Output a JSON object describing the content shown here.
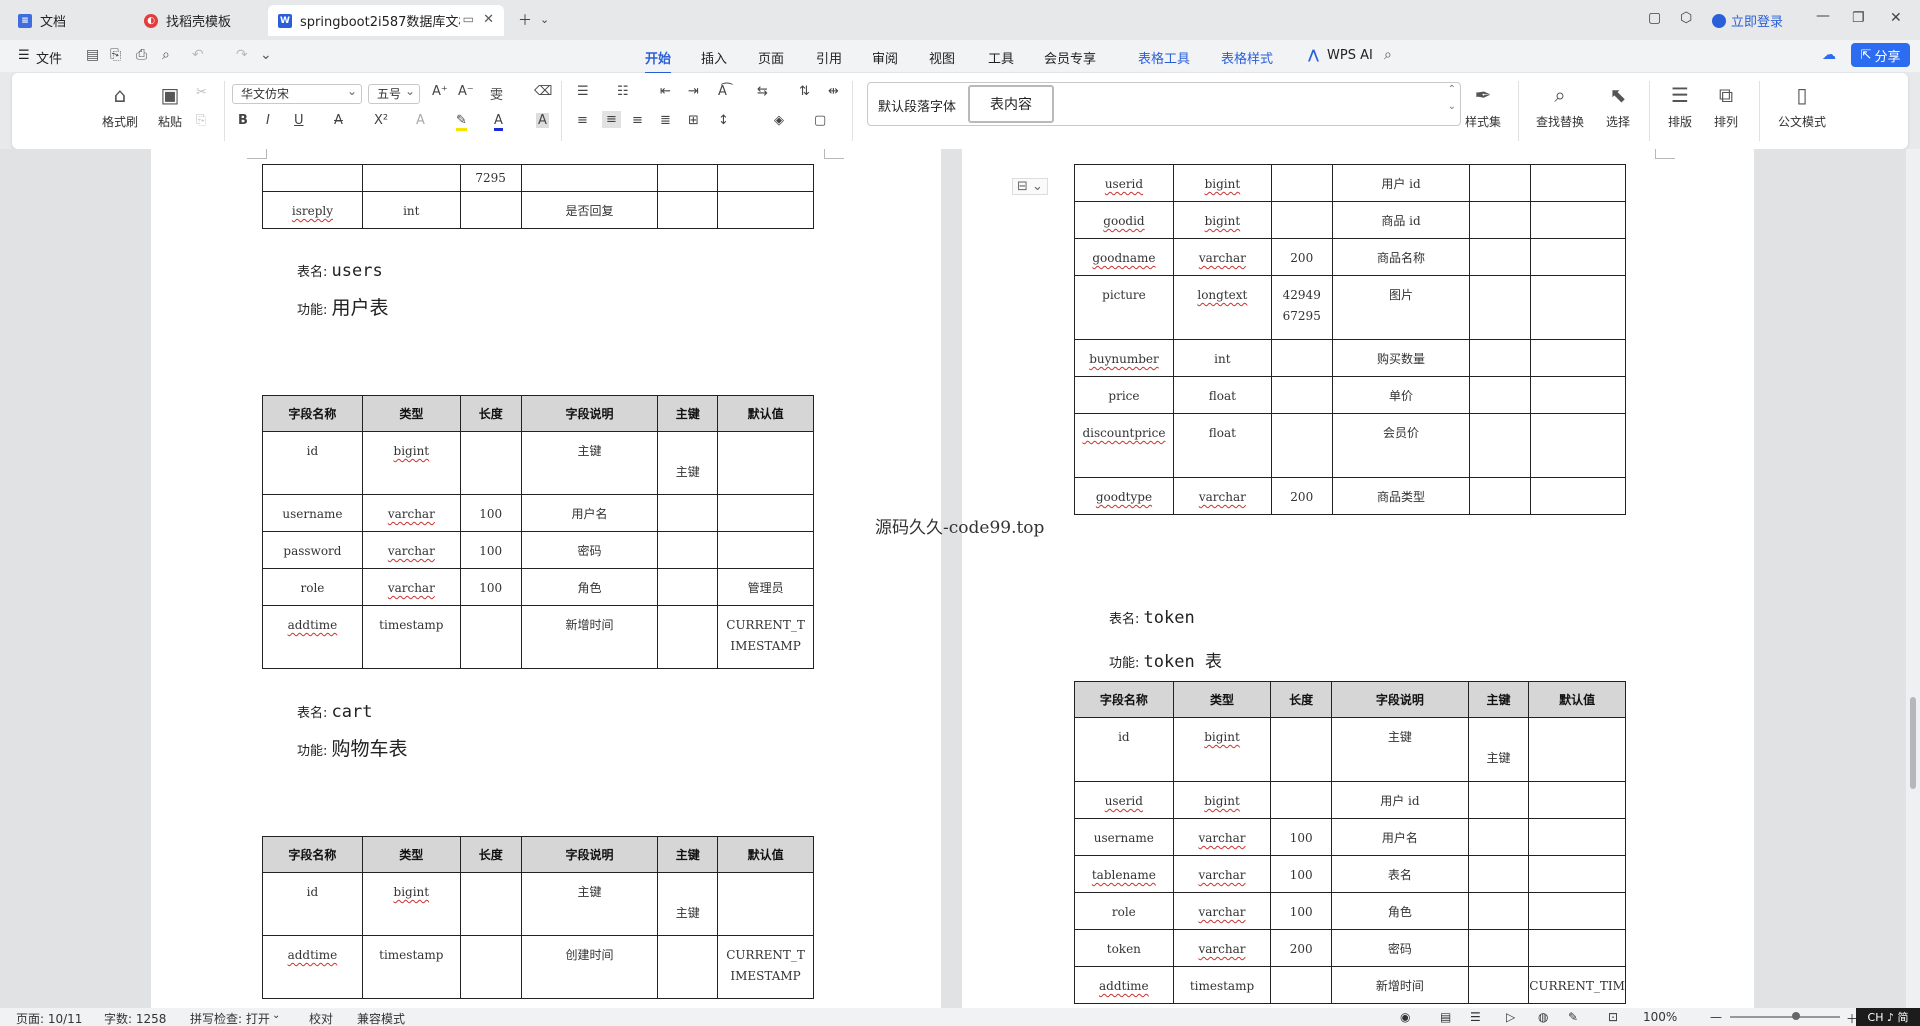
{
  "tabs": [
    {
      "label": "文档",
      "icon": "doc-icon",
      "color": "#3f6de0"
    },
    {
      "label": "找稻壳模板",
      "icon": "docer-icon",
      "color": "#e23c3c"
    },
    {
      "label": "springboot2i587数据库文档",
      "icon": "word-icon",
      "color": "#2b5fd9"
    }
  ],
  "login_label": "立即登录",
  "menu": {
    "file": "文件",
    "items": [
      "开始",
      "插入",
      "页面",
      "引用",
      "审阅",
      "视图",
      "工具",
      "会员专享",
      "表格工具",
      "表格样式"
    ],
    "ai": "WPS AI",
    "share": "分享"
  },
  "ribbon": {
    "format_painter": "格式刷",
    "paste": "粘贴",
    "font": "华文仿宋",
    "size": "五号",
    "style_normal": "默认段落字体",
    "style_table": "表内容",
    "style_set": "样式集",
    "find_replace": "查找替换",
    "select": "选择",
    "layout": "排版",
    "arrange": "排列",
    "official": "公文模式"
  },
  "left_page": {
    "top_table": {
      "rows": [
        [
          "",
          "",
          "7295",
          "",
          "",
          ""
        ],
        [
          "isreply",
          "int",
          "",
          "是否回复",
          "",
          ""
        ]
      ]
    },
    "users": {
      "name_label": "表名:",
      "name": "users",
      "func_label": "功能:",
      "func": "用户表",
      "headers": [
        "字段名称",
        "类型",
        "长度",
        "字段说明",
        "主键",
        "默认值"
      ],
      "rows": [
        [
          "id",
          "bigint",
          "",
          "主键",
          "主键",
          ""
        ],
        [
          "username",
          "varchar",
          "100",
          "用户名",
          "",
          ""
        ],
        [
          "password",
          "varchar",
          "100",
          "密码",
          "",
          ""
        ],
        [
          "role",
          "varchar",
          "100",
          "角色",
          "",
          "管理员"
        ],
        [
          "addtime",
          "timestamp",
          "",
          "新增时间",
          "",
          "CURRENT_TIMESTAMP"
        ]
      ]
    },
    "cart": {
      "name_label": "表名:",
      "name": "cart",
      "func_label": "功能:",
      "func": "购物车表",
      "headers": [
        "字段名称",
        "类型",
        "长度",
        "字段说明",
        "主键",
        "默认值"
      ],
      "rows": [
        [
          "id",
          "bigint",
          "",
          "主键",
          "主键",
          ""
        ],
        [
          "addtime",
          "timestamp",
          "",
          "创建时间",
          "",
          "CURRENT_TIMESTAMP"
        ]
      ]
    }
  },
  "watermark": "源码久久-code99.top",
  "right_page": {
    "cart_cont": {
      "rows": [
        [
          "userid",
          "bigint",
          "",
          "用户 id",
          "",
          ""
        ],
        [
          "goodid",
          "bigint",
          "",
          "商品 id",
          "",
          ""
        ],
        [
          "goodname",
          "varchar",
          "200",
          "商品名称",
          "",
          ""
        ],
        [
          "picture",
          "longtext",
          "4294967295",
          "图片",
          "",
          ""
        ],
        [
          "buynumber",
          "int",
          "",
          "购买数量",
          "",
          ""
        ],
        [
          "price",
          "float",
          "",
          "单价",
          "",
          ""
        ],
        [
          "discountprice",
          "float",
          "",
          "会员价",
          "",
          ""
        ],
        [
          "goodtype",
          "varchar",
          "200",
          "商品类型",
          "",
          ""
        ]
      ]
    },
    "token": {
      "name_label": "表名:",
      "name": "token",
      "func_label": "功能:",
      "func": "token 表",
      "headers": [
        "字段名称",
        "类型",
        "长度",
        "字段说明",
        "主键",
        "默认值"
      ],
      "rows": [
        [
          "id",
          "bigint",
          "",
          "主键",
          "主键",
          ""
        ],
        [
          "userid",
          "bigint",
          "",
          "用户 id",
          "",
          ""
        ],
        [
          "username",
          "varchar",
          "100",
          "用户名",
          "",
          ""
        ],
        [
          "tablename",
          "varchar",
          "100",
          "表名",
          "",
          ""
        ],
        [
          "role",
          "varchar",
          "100",
          "角色",
          "",
          ""
        ],
        [
          "token",
          "varchar",
          "200",
          "密码",
          "",
          ""
        ],
        [
          "addtime",
          "timestamp",
          "",
          "新增时间",
          "",
          "CURRENT_TIM"
        ]
      ]
    }
  },
  "status": {
    "page": "页面: 10/11",
    "words": "字数: 1258",
    "spell": "拼写检查: 打开",
    "proof": "校对",
    "compat": "兼容模式",
    "zoom": "100%",
    "ime": "CH ♪ 简"
  }
}
